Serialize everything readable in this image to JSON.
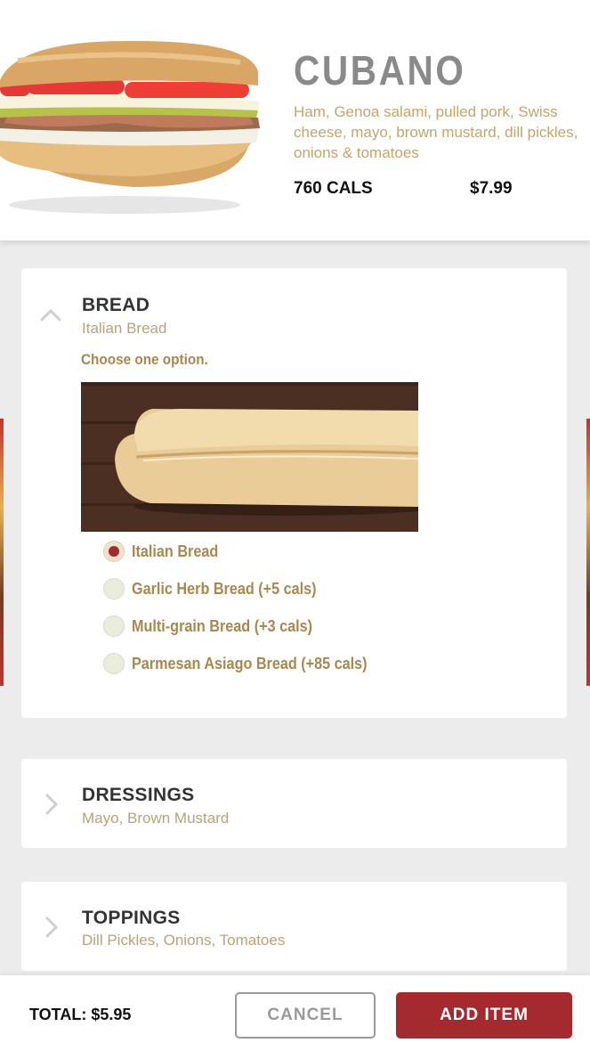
{
  "item": {
    "name": "CUBANO",
    "description": "Ham, Genoa salami, pulled pork, Swiss cheese, mayo, brown mustard, dill pickles, onions & tomatoes",
    "calories": "760 CALS",
    "price": "$7.99",
    "image_icon": "sandwich-image"
  },
  "sections": {
    "bread": {
      "title": "BREAD",
      "selected": "Italian Bread",
      "instruction": "Choose one option.",
      "expanded": true,
      "options": [
        {
          "label": "Italian Bread",
          "selected": true
        },
        {
          "label": "Garlic Herb Bread (+5 cals)",
          "selected": false
        },
        {
          "label": "Multi-grain Bread (+3 cals)",
          "selected": false
        },
        {
          "label": "Parmesan Asiago Bread (+85 cals)",
          "selected": false
        }
      ]
    },
    "dressings": {
      "title": "DRESSINGS",
      "selected": "Mayo, Brown Mustard",
      "expanded": false
    },
    "toppings": {
      "title": "TOPPINGS",
      "selected": "Dill Pickles, Onions, Tomatoes",
      "expanded": false
    }
  },
  "footer": {
    "total": "TOTAL: $5.95",
    "cancel_label": "CANCEL",
    "add_label": "ADD ITEM"
  },
  "colors": {
    "accent": "#a52a2f",
    "gold": "#a8884f",
    "title_gray": "#8a8a8a",
    "background": "#ececec"
  }
}
